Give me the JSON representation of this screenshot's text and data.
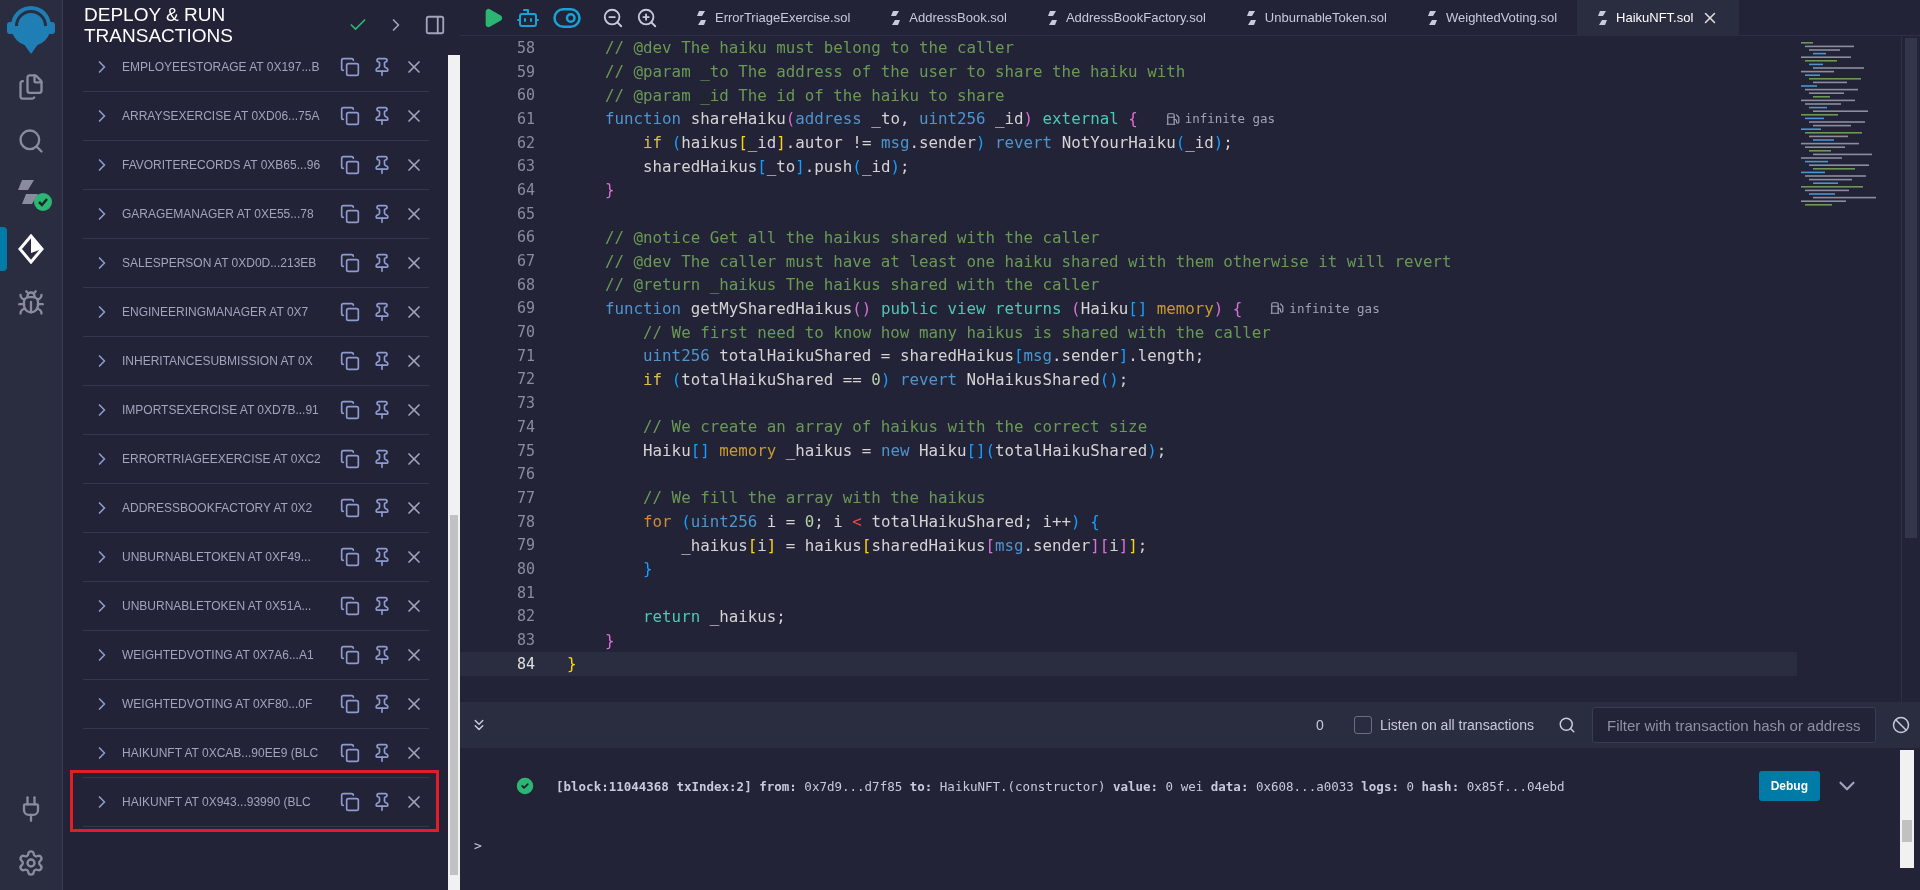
{
  "icon_bar": {
    "top": [
      {
        "kind": "files",
        "selected": false
      },
      {
        "kind": "search",
        "selected": false
      },
      {
        "kind": "compiler",
        "selected": false
      },
      {
        "kind": "deploy",
        "selected": true
      },
      {
        "kind": "debugger",
        "selected": false
      }
    ],
    "bottom": [
      {
        "kind": "plugin",
        "selected": false
      },
      {
        "kind": "settings",
        "selected": false
      }
    ]
  },
  "side_panel": {
    "title": "DEPLOY & RUN TRANSACTIONS",
    "deployed_contracts": [
      {
        "label": "EMPLOYEESTORAGE AT 0X197...B",
        "highlighted": false
      },
      {
        "label": "ARRAYSEXERCISE AT 0XD06...75A",
        "highlighted": false
      },
      {
        "label": "FAVORITERECORDS AT 0XB65...96",
        "highlighted": false
      },
      {
        "label": "GARAGEMANAGER AT 0XE55...78",
        "highlighted": false
      },
      {
        "label": "SALESPERSON AT 0XD0D...213EB",
        "highlighted": false
      },
      {
        "label": "ENGINEERINGMANAGER AT 0X7",
        "highlighted": false
      },
      {
        "label": "INHERITANCESUBMISSION AT 0X",
        "highlighted": false
      },
      {
        "label": "IMPORTSEXERCISE AT 0XD7B...91",
        "highlighted": false
      },
      {
        "label": "ERRORTRIAGEEXERCISE AT 0XC2",
        "highlighted": false
      },
      {
        "label": "ADDRESSBOOKFACTORY AT 0X2",
        "highlighted": false
      },
      {
        "label": "UNBURNABLETOKEN AT 0XF49...",
        "highlighted": false
      },
      {
        "label": "UNBURNABLETOKEN AT 0X51A...",
        "highlighted": false
      },
      {
        "label": "WEIGHTEDVOTING AT 0X7A6...A1",
        "highlighted": false
      },
      {
        "label": "WEIGHTEDVOTING AT 0XF80...0F",
        "highlighted": false
      },
      {
        "label": "HAIKUNFT AT 0XCAB...90EE9 (BLC",
        "highlighted": false
      },
      {
        "label": "HAIKUNFT AT 0X943...93990 (BLC",
        "highlighted": true
      }
    ]
  },
  "editor": {
    "tabs": [
      {
        "label": "ErrorTriageExercise.sol",
        "selected": false
      },
      {
        "label": "AddressBook.sol",
        "selected": false
      },
      {
        "label": "AddressBookFactory.sol",
        "selected": false
      },
      {
        "label": "UnburnableToken.sol",
        "selected": false
      },
      {
        "label": "WeightedVoting.sol",
        "selected": false
      },
      {
        "label": "HaikuNFT.sol",
        "selected": true
      }
    ],
    "lines": [
      {
        "number": "58",
        "current": false,
        "tokens": [
          {
            "kind": "comment",
            "text": "    // @dev The haiku must belong to the caller"
          }
        ]
      },
      {
        "number": "59",
        "current": false,
        "tokens": [
          {
            "kind": "comment",
            "text": "    // @param _to The address of the user to share the haiku with"
          }
        ]
      },
      {
        "number": "60",
        "current": false,
        "tokens": [
          {
            "kind": "comment",
            "text": "    // @param _id The id of the haiku to share"
          }
        ]
      },
      {
        "number": "61",
        "current": false,
        "hint": "infinite gas",
        "tokens": [
          {
            "kind": "keyword",
            "text": "    function"
          },
          {
            "kind": "plain",
            "text": " shareHaiku"
          },
          {
            "kind": "bracket2",
            "text": "("
          },
          {
            "kind": "keyword",
            "text": "address"
          },
          {
            "kind": "plain",
            "text": " _to, "
          },
          {
            "kind": "keyword",
            "text": "uint256"
          },
          {
            "kind": "plain",
            "text": " _id"
          },
          {
            "kind": "bracket2",
            "text": ") "
          },
          {
            "kind": "modifier",
            "text": "external "
          },
          {
            "kind": "bracket2",
            "text": "{"
          }
        ]
      },
      {
        "number": "62",
        "current": false,
        "tokens": [
          {
            "kind": "control",
            "text": "        if "
          },
          {
            "kind": "bracket3",
            "text": "("
          },
          {
            "kind": "plain",
            "text": "haikus"
          },
          {
            "kind": "bracket1",
            "text": "["
          },
          {
            "kind": "plain",
            "text": "_id"
          },
          {
            "kind": "bracket1",
            "text": "]"
          },
          {
            "kind": "plain",
            "text": ".autor != "
          },
          {
            "kind": "keyword",
            "text": "msg"
          },
          {
            "kind": "plain",
            "text": ".sender"
          },
          {
            "kind": "bracket3",
            "text": ") "
          },
          {
            "kind": "keyword",
            "text": "revert"
          },
          {
            "kind": "plain",
            "text": " NotYourHaiku"
          },
          {
            "kind": "bracket3",
            "text": "("
          },
          {
            "kind": "plain",
            "text": "_id"
          },
          {
            "kind": "bracket3",
            "text": ")"
          },
          {
            "kind": "plain",
            "text": ";"
          }
        ]
      },
      {
        "number": "63",
        "current": false,
        "tokens": [
          {
            "kind": "plain",
            "text": "        sharedHaikus"
          },
          {
            "kind": "bracket3",
            "text": "["
          },
          {
            "kind": "plain",
            "text": "_to"
          },
          {
            "kind": "bracket3",
            "text": "]"
          },
          {
            "kind": "plain",
            "text": ".push"
          },
          {
            "kind": "bracket3",
            "text": "("
          },
          {
            "kind": "plain",
            "text": "_id"
          },
          {
            "kind": "bracket3",
            "text": ")"
          },
          {
            "kind": "plain",
            "text": ";"
          }
        ]
      },
      {
        "number": "64",
        "current": false,
        "tokens": [
          {
            "kind": "bracket2",
            "text": "    }"
          }
        ]
      },
      {
        "number": "65",
        "current": false
      },
      {
        "number": "66",
        "current": false,
        "tokens": [
          {
            "kind": "comment",
            "text": "    // @notice Get all the haikus shared with the caller"
          }
        ]
      },
      {
        "number": "67",
        "current": false,
        "tokens": [
          {
            "kind": "comment",
            "text": "    // @dev The caller must have at least one haiku shared with them otherwise it will revert"
          }
        ]
      },
      {
        "number": "68",
        "current": false,
        "tokens": [
          {
            "kind": "comment",
            "text": "    // @return _haikus The haikus shared with the caller"
          }
        ]
      },
      {
        "number": "69",
        "current": false,
        "hint": "infinite gas",
        "tokens": [
          {
            "kind": "keyword",
            "text": "    function"
          },
          {
            "kind": "plain",
            "text": " getMySharedHaikus"
          },
          {
            "kind": "bracket2",
            "text": "() "
          },
          {
            "kind": "modifier",
            "text": "public view returns "
          },
          {
            "kind": "bracket2",
            "text": "("
          },
          {
            "kind": "plain",
            "text": "Haiku"
          },
          {
            "kind": "bracket3",
            "text": "[] "
          },
          {
            "kind": "storage",
            "text": "memory"
          },
          {
            "kind": "bracket2",
            "text": ") {"
          }
        ]
      },
      {
        "number": "70",
        "current": false,
        "tokens": [
          {
            "kind": "comment",
            "text": "        // We first need to know how many haikus is shared with the caller"
          }
        ]
      },
      {
        "number": "71",
        "current": false,
        "tokens": [
          {
            "kind": "keyword",
            "text": "        uint256"
          },
          {
            "kind": "plain",
            "text": " totalHaikuShared = sharedHaikus"
          },
          {
            "kind": "bracket3",
            "text": "["
          },
          {
            "kind": "keyword",
            "text": "msg"
          },
          {
            "kind": "plain",
            "text": ".sender"
          },
          {
            "kind": "bracket3",
            "text": "]"
          },
          {
            "kind": "plain",
            "text": ".length;"
          }
        ]
      },
      {
        "number": "72",
        "current": false,
        "tokens": [
          {
            "kind": "control",
            "text": "        if "
          },
          {
            "kind": "bracket3",
            "text": "("
          },
          {
            "kind": "plain",
            "text": "totalHaikuShared == "
          },
          {
            "kind": "number",
            "text": "0"
          },
          {
            "kind": "bracket3",
            "text": ") "
          },
          {
            "kind": "keyword",
            "text": "revert"
          },
          {
            "kind": "plain",
            "text": " NoHaikusShared"
          },
          {
            "kind": "bracket3",
            "text": "()"
          },
          {
            "kind": "plain",
            "text": ";"
          }
        ]
      },
      {
        "number": "73",
        "current": false
      },
      {
        "number": "74",
        "current": false,
        "tokens": [
          {
            "kind": "comment",
            "text": "        // We create an array of haikus with the correct size"
          }
        ]
      },
      {
        "number": "75",
        "current": false,
        "tokens": [
          {
            "kind": "plain",
            "text": "        Haiku"
          },
          {
            "kind": "bracket3",
            "text": "[] "
          },
          {
            "kind": "storage",
            "text": "memory"
          },
          {
            "kind": "plain",
            "text": " _haikus = "
          },
          {
            "kind": "keyword",
            "text": "new"
          },
          {
            "kind": "plain",
            "text": " Haiku"
          },
          {
            "kind": "bracket3",
            "text": "[]("
          },
          {
            "kind": "plain",
            "text": "totalHaikuShared"
          },
          {
            "kind": "bracket3",
            "text": ")"
          },
          {
            "kind": "plain",
            "text": ";"
          }
        ]
      },
      {
        "number": "76",
        "current": false
      },
      {
        "number": "77",
        "current": false,
        "tokens": [
          {
            "kind": "comment",
            "text": "        // We fill the array with the haikus"
          }
        ]
      },
      {
        "number": "78",
        "current": false,
        "tokens": [
          {
            "kind": "loop",
            "text": "        for "
          },
          {
            "kind": "bracket3",
            "text": "("
          },
          {
            "kind": "keyword",
            "text": "uint256"
          },
          {
            "kind": "plain",
            "text": " i = "
          },
          {
            "kind": "number",
            "text": "0"
          },
          {
            "kind": "plain",
            "text": "; i "
          },
          {
            "kind": "operator",
            "text": "<"
          },
          {
            "kind": "plain",
            "text": " totalHaikuShared; i++"
          },
          {
            "kind": "bracket3",
            "text": ") {"
          }
        ]
      },
      {
        "number": "79",
        "current": false,
        "tokens": [
          {
            "kind": "plain",
            "text": "            _haikus"
          },
          {
            "kind": "bracket1",
            "text": "["
          },
          {
            "kind": "plain",
            "text": "i"
          },
          {
            "kind": "bracket1",
            "text": "]"
          },
          {
            "kind": "plain",
            "text": " = haikus"
          },
          {
            "kind": "bracket1",
            "text": "["
          },
          {
            "kind": "plain",
            "text": "sharedHaikus"
          },
          {
            "kind": "bracket2",
            "text": "["
          },
          {
            "kind": "keyword",
            "text": "msg"
          },
          {
            "kind": "plain",
            "text": ".sender"
          },
          {
            "kind": "bracket2",
            "text": "]["
          },
          {
            "kind": "plain",
            "text": "i"
          },
          {
            "kind": "bracket2",
            "text": "]"
          },
          {
            "kind": "bracket1",
            "text": "]"
          },
          {
            "kind": "plain",
            "text": ";"
          }
        ]
      },
      {
        "number": "80",
        "current": false,
        "tokens": [
          {
            "kind": "bracket3",
            "text": "        }"
          }
        ]
      },
      {
        "number": "81",
        "current": false
      },
      {
        "number": "82",
        "current": false,
        "tokens": [
          {
            "kind": "modifier",
            "text": "        return"
          },
          {
            "kind": "plain",
            "text": " _haikus;"
          }
        ]
      },
      {
        "number": "83",
        "current": false,
        "tokens": [
          {
            "kind": "bracket2",
            "text": "    }"
          }
        ]
      },
      {
        "number": "84",
        "current": true,
        "tokens": [
          {
            "kind": "bracket1",
            "text": "}"
          }
        ]
      }
    ]
  },
  "terminal": {
    "count": "0",
    "listen_all": {
      "label": "Listen on all transactions",
      "checked": false
    },
    "filter": {
      "placeholder": "Filter with transaction hash or address"
    },
    "log": [
      {
        "kind": "success",
        "text": "**[block:11044368 txIndex:2]**  **from:** 0x7d9...d7f85 **to:** HaikuNFT.(constructor) **value:** 0 wei **data:** 0x608...a0033 **logs:** 0 **hash:** 0x85f...04ebd",
        "button": "Debug"
      }
    ],
    "prompt": ">"
  }
}
